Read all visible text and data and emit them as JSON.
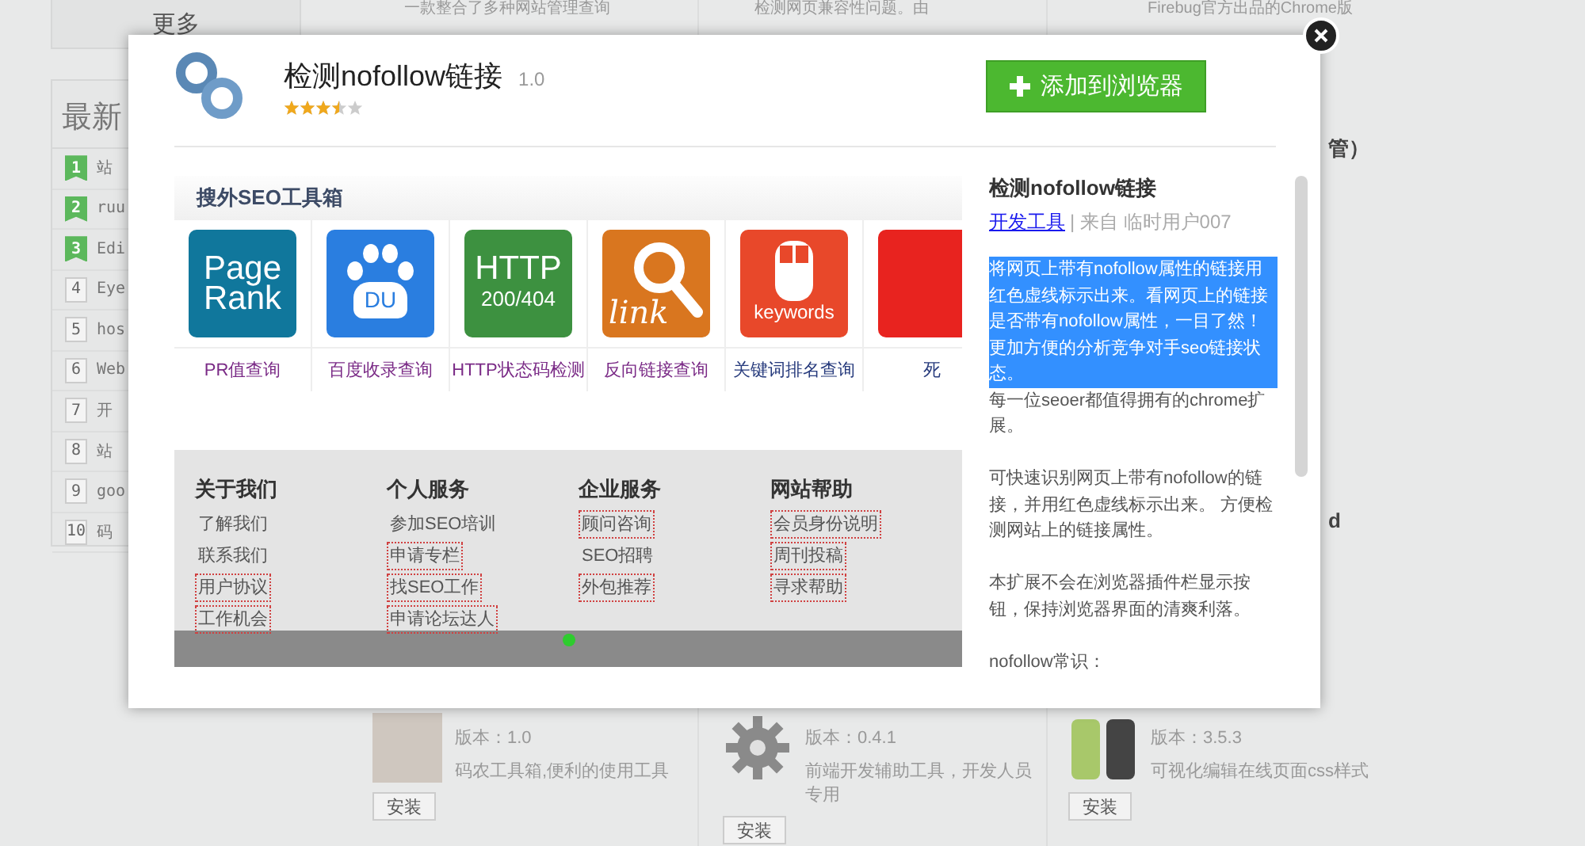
{
  "background": {
    "more_button": "更多",
    "latest_panel": {
      "title": "最新",
      "items": [
        {
          "rank": "1",
          "label": "站",
          "highlighted": true
        },
        {
          "rank": "2",
          "label": "ruu",
          "highlighted": true
        },
        {
          "rank": "3",
          "label": "Edi",
          "highlighted": true
        },
        {
          "rank": "4",
          "label": "Eye",
          "highlighted": false
        },
        {
          "rank": "5",
          "label": "hos",
          "highlighted": false
        },
        {
          "rank": "6",
          "label": "Web",
          "highlighted": false
        },
        {
          "rank": "7",
          "label": "开",
          "highlighted": false
        },
        {
          "rank": "8",
          "label": "站",
          "highlighted": false
        },
        {
          "rank": "9",
          "label": "goo",
          "highlighted": false
        },
        {
          "rank": "10",
          "label": "码",
          "highlighted": false
        }
      ]
    },
    "top_cards": [
      {
        "description": "一款整合了多种网站管理查询"
      },
      {
        "description": "检测网页兼容性问题。由"
      },
      {
        "description": "Firebug官方出品的Chrome版"
      }
    ],
    "side_texts": [
      "管）",
      "d"
    ],
    "bottom_cards": [
      {
        "kind": "photo",
        "version": "版本：1.0",
        "description": "码农工具箱,便利的使用工具",
        "install_button": "安装"
      },
      {
        "kind": "gear",
        "version": "版本：0.4.1",
        "description": "前端开发辅助工具，开发人员专用",
        "install_button": "安装"
      },
      {
        "kind": "bars",
        "version": "版本：3.5.3",
        "description": "可视化编辑在线页面css样式",
        "install_button": "安装"
      }
    ]
  },
  "modal": {
    "title": "检测nofollow链接",
    "version": "1.0",
    "stars": 3.5,
    "add_button": "添加到浏览器",
    "preview": {
      "header": "搜外SEO工具箱",
      "tools": [
        {
          "kind": "text",
          "color": "#10779c",
          "tile_lines": [
            "Page",
            "Rank"
          ],
          "label": "PR值查询",
          "visited": true
        },
        {
          "kind": "paw",
          "color": "#2a7ee0",
          "tile_lines": [
            "DU"
          ],
          "label": "百度收录查询",
          "visited": true
        },
        {
          "kind": "text",
          "color": "#3d9140",
          "tile_lines": [
            "HTTP",
            "200/404"
          ],
          "label": "HTTP状态码检测",
          "visited": true
        },
        {
          "kind": "magnifier",
          "color": "#d9761f",
          "tile_lines": [
            "link"
          ],
          "label": "反向链接查询",
          "visited": true
        },
        {
          "kind": "mouse",
          "color": "#e8482a",
          "tile_lines": [
            "keywords"
          ],
          "label": "关键词排名查询",
          "visited": false
        },
        {
          "kind": "text",
          "color": "#e8231f",
          "label": "死",
          "visited": false
        }
      ],
      "footer_columns": [
        {
          "title": "关于我们",
          "links": [
            {
              "text": "了解我们",
              "nofollow": false
            },
            {
              "text": "联系我们",
              "nofollow": false
            },
            {
              "text": "用户协议",
              "nofollow": true
            },
            {
              "text": "工作机会",
              "nofollow": true
            }
          ]
        },
        {
          "title": "个人服务",
          "links": [
            {
              "text": "参加SEO培训",
              "nofollow": false
            },
            {
              "text": "申请专栏",
              "nofollow": true
            },
            {
              "text": "找SEO工作",
              "nofollow": true
            },
            {
              "text": "申请论坛达人",
              "nofollow": true
            }
          ]
        },
        {
          "title": "企业服务",
          "links": [
            {
              "text": "顾问咨询",
              "nofollow": true
            },
            {
              "text": "SEO招聘",
              "nofollow": false
            },
            {
              "text": "外包推荐",
              "nofollow": true
            }
          ]
        },
        {
          "title": "网站帮助",
          "links": [
            {
              "text": "会员身份说明",
              "nofollow": true
            },
            {
              "text": "周刊投稿",
              "nofollow": true
            },
            {
              "text": "寻求帮助",
              "nofollow": true
            }
          ]
        }
      ]
    },
    "details": {
      "title": "检测nofollow链接",
      "category_link": "开发工具",
      "source": "| 来自 临时用户007",
      "paragraphs": [
        {
          "text": "将网页上带有nofollow属性的链接用红色虚线标示出来。看网页上的链接是否带有nofollow属性，一目了然！更加方便的分析竞争对手seo链接状态。",
          "selected": true
        },
        {
          "text": "每一位seoer都值得拥有的chrome扩展。",
          "selected": false
        },
        {
          "text": "可快速识别网页上带有nofollow的链接，并用红色虚线标示出来。  方便检测网站上的链接属性。",
          "selected": false
        },
        {
          "text": "本扩展不会在浏览器插件栏显示按钮，保持浏览器界面的清爽利落。",
          "selected": false
        },
        {
          "text": "nofollow常识：",
          "selected": false
        }
      ]
    }
  }
}
